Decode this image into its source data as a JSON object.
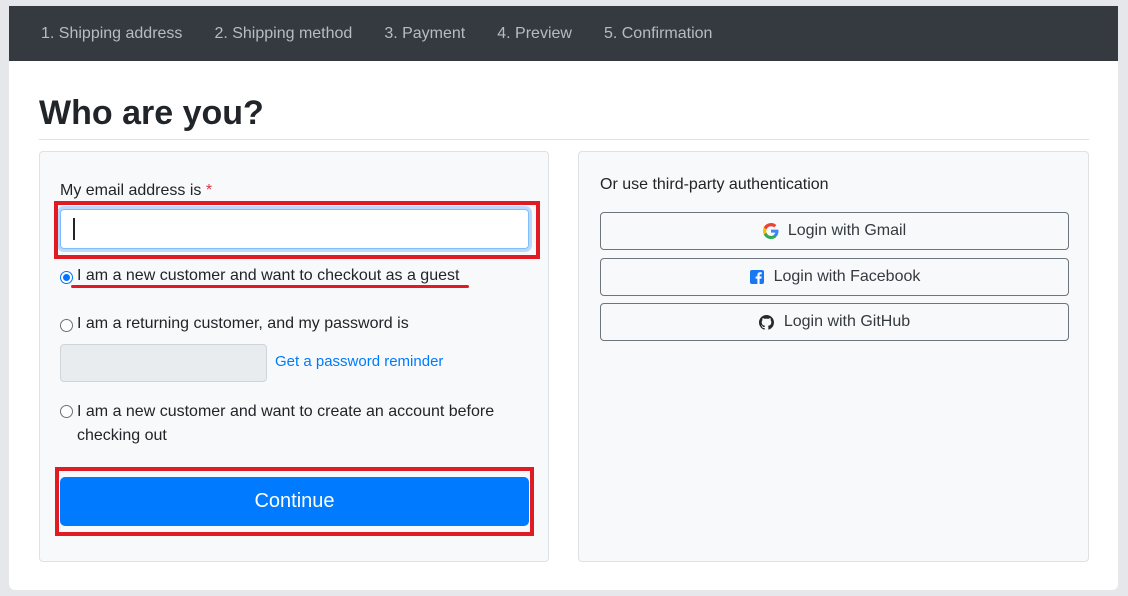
{
  "steps": [
    "1. Shipping address",
    "2. Shipping method",
    "3. Payment",
    "4. Preview",
    "5. Confirmation"
  ],
  "page_title": "Who are you?",
  "form": {
    "email_label": "My email address is",
    "required_mark": "*",
    "email_value": "",
    "option_guest": "I am a new customer and want to checkout as a guest",
    "option_returning": "I am a returning customer, and my password is",
    "password_reminder": "Get a password reminder",
    "option_create": "I am a new customer and want to create an account before checking out",
    "continue_label": "Continue",
    "selected_option": "guest"
  },
  "third_party": {
    "label": "Or use third-party authentication",
    "buttons": [
      {
        "label": "Login with Gmail",
        "icon": "google-icon"
      },
      {
        "label": "Login with Facebook",
        "icon": "facebook-icon"
      },
      {
        "label": "Login with GitHub",
        "icon": "github-icon"
      }
    ]
  },
  "colors": {
    "nav_bg": "#343a40",
    "primary": "#007bff",
    "highlight": "#e01b24",
    "required": "#dc3545"
  }
}
